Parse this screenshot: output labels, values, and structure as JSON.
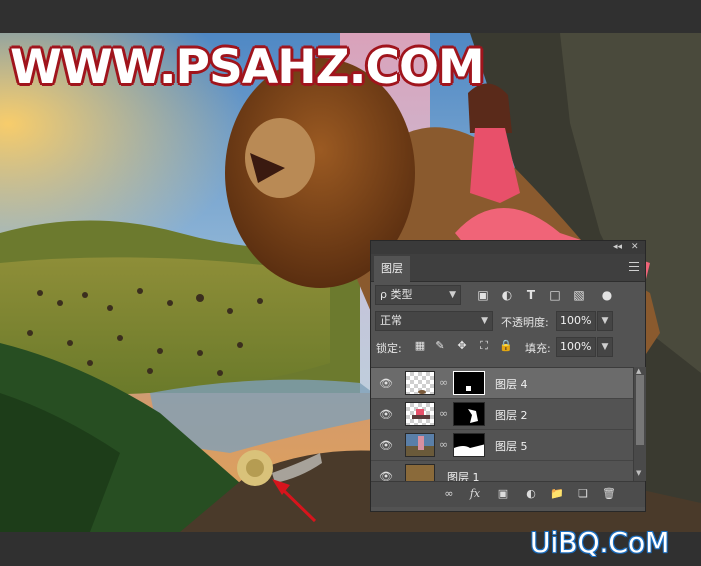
{
  "watermarks": {
    "top": "WWW.PSAHZ.COM",
    "bottom": "UiBQ.CoM"
  },
  "panel": {
    "collapse_label": "◂◂",
    "close_label": "✕",
    "tab_label": "图层",
    "filter": {
      "kind_label": "ρ 类型",
      "icons": [
        "image-filter-icon",
        "adjustment-filter-icon",
        "text-filter-icon",
        "shape-filter-icon",
        "smart-object-filter-icon",
        "filter-toggle-icon"
      ]
    },
    "blend": {
      "mode": "正常",
      "opacity_label": "不透明度:",
      "opacity_value": "100%"
    },
    "lock": {
      "label": "锁定:",
      "fill_label": "填充:",
      "fill_value": "100%"
    },
    "layers": [
      {
        "name": "图层 4",
        "selected": true
      },
      {
        "name": "图层 2",
        "selected": false
      },
      {
        "name": "图层 5",
        "selected": false
      },
      {
        "name": "图层 1",
        "selected": false
      }
    ],
    "bottom_tools": [
      "link-layers-icon",
      "fx-icon",
      "add-mask-icon",
      "adjustment-layer-icon",
      "new-group-icon",
      "new-layer-icon",
      "delete-layer-icon"
    ]
  },
  "colors": {
    "panel_bg": "#535353",
    "selected_layer": "#6b6b6b",
    "watermark_outline": "#a0141c",
    "bottom_watermark": "#1a6fc2"
  }
}
